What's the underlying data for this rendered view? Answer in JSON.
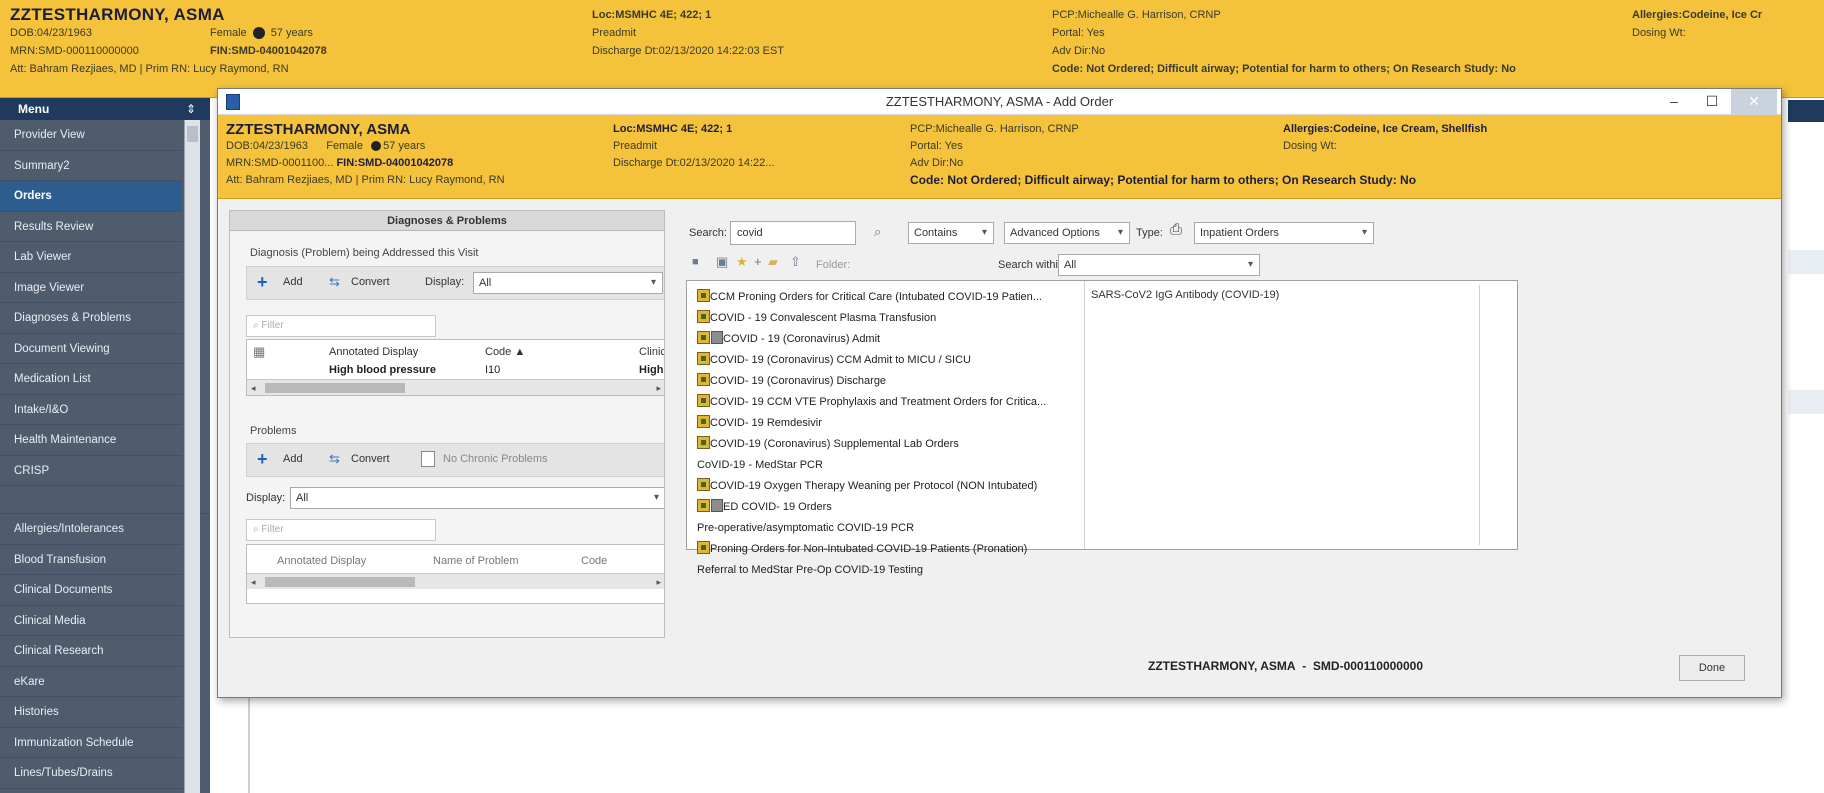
{
  "banner": {
    "patient_name": "ZZTESTHARMONY, ASMA",
    "dob": "DOB:04/23/1963",
    "mrn": "MRN:SMD-000110000000",
    "attending": "Att: Bahram Rezjiaes, MD | Prim RN: Lucy Raymond, RN",
    "sex": "Female",
    "age": "57 years",
    "fin": "FIN:SMD-04001042078",
    "loc": "Loc:MSMHC 4E; 422; 1",
    "encounter_type": "Preadmit",
    "discharge": "Discharge Dt:02/13/2020 14:22:03 EST",
    "pcp": "PCP:Michealle G. Harrison, CRNP",
    "portal": "Portal: Yes",
    "adv_dir": "Adv Dir:No",
    "code": "Code: Not Ordered; Difficult airway; Potential for harm to others; On Research Study: No",
    "allergies": "Allergies:Codeine, Ice Cr",
    "dosing_wt": "Dosing Wt:"
  },
  "menu": {
    "header": "Menu",
    "pin": "⇕",
    "items_top": [
      {
        "label": "Provider View",
        "active": false
      },
      {
        "label": "Summary2",
        "active": false
      },
      {
        "label": "Orders",
        "active": true
      },
      {
        "label": "Results Review",
        "active": false
      },
      {
        "label": "Lab Viewer",
        "active": false
      },
      {
        "label": "Image Viewer",
        "active": false
      },
      {
        "label": "Diagnoses & Problems",
        "active": false
      },
      {
        "label": "Document Viewing",
        "active": false
      },
      {
        "label": "Medication List",
        "active": false
      },
      {
        "label": "Intake/I&O",
        "active": false
      },
      {
        "label": "Health Maintenance",
        "active": false
      },
      {
        "label": "CRISP",
        "active": false
      }
    ],
    "items_bottom": [
      {
        "label": "Allergies/Intolerances"
      },
      {
        "label": "Blood Transfusion"
      },
      {
        "label": "Clinical Documents"
      },
      {
        "label": "Clinical Media"
      },
      {
        "label": "Clinical Research"
      },
      {
        "label": "eKare"
      },
      {
        "label": "Histories"
      },
      {
        "label": "Immunization Schedule"
      },
      {
        "label": "Lines/Tubes/Drains"
      }
    ]
  },
  "dialog": {
    "title": "ZZTESTHARMONY, ASMA - Add Order",
    "min": "–",
    "max": "☐",
    "close": "✕",
    "banner": {
      "patient_name": "ZZTESTHARMONY, ASMA",
      "dob": "DOB:04/23/1963",
      "sex": "Female",
      "age": "57 years",
      "mrn": "MRN:SMD-0001100...",
      "fin": "FIN:SMD-04001042078",
      "attending": "Att: Bahram Rezjiaes, MD | Prim RN: Lucy Raymond, RN",
      "loc": "Loc:MSMHC 4E; 422; 1",
      "encounter_type": "Preadmit",
      "discharge": "Discharge Dt:02/13/2020 14:22...",
      "pcp": "PCP:Michealle G. Harrison, CRNP",
      "portal": "Portal: Yes",
      "adv_dir": "Adv Dir:No",
      "allergies": "Allergies:Codeine, Ice Cream, Shellfish",
      "dosing_wt": "Dosing Wt:",
      "code": "Code: Not Ordered; Difficult airway; Potential for harm to others; On Research Study: No"
    },
    "dx_panel": {
      "header": "Diagnoses & Problems",
      "diagnosis_section_label": "Diagnosis (Problem) being Addressed this Visit",
      "add": "Add",
      "convert": "Convert",
      "display_label": "Display:",
      "display_value": "All",
      "filter_placeholder": "Filter",
      "grid_headers": {
        "annotated_display": "Annotated Display",
        "code": "Code ▲",
        "clinical": "Clinic"
      },
      "grid_row": {
        "annotated_display": "High blood pressure",
        "code": "I10",
        "clinical": "High"
      },
      "problems_label": "Problems",
      "no_chronic": "No Chronic Problems",
      "problems_display_label": "Display:",
      "problems_display_value": "All",
      "problems_filter_placeholder": "Filter",
      "problems_grid_headers": {
        "annotated_display": "Annotated Display",
        "name_of_problem": "Name of Problem",
        "code": "Code"
      }
    },
    "search": {
      "label": "Search:",
      "value": "covid",
      "contains": "Contains",
      "advanced": "Advanced Options",
      "type_label": "Type:",
      "type_value": "Inpatient Orders",
      "folder": "Folder:",
      "search_within_label": "Search within:",
      "search_within_value": "All"
    },
    "results": [
      {
        "text": "CCM Proning Orders for Critical Care (Intubated COVID-19 Patien...",
        "icon": "order-set",
        "icon2": false
      },
      {
        "text": "COVID - 19 Convalescent Plasma Transfusion",
        "icon": "order-set",
        "icon2": false
      },
      {
        "text": "COVID - 19 (Coronavirus) Admit",
        "icon": "order-set",
        "icon2": true
      },
      {
        "text": "COVID- 19 (Coronavirus) CCM Admit to MICU / SICU",
        "icon": "order-set",
        "icon2": false
      },
      {
        "text": "COVID- 19 (Coronavirus) Discharge",
        "icon": "order-set",
        "icon2": false
      },
      {
        "text": "COVID- 19 CCM VTE Prophylaxis and Treatment Orders for Critica...",
        "icon": "order-set",
        "icon2": false
      },
      {
        "text": "COVID- 19 Remdesivir",
        "icon": "order-set",
        "icon2": false
      },
      {
        "text": "COVID-19 (Coronavirus) Supplemental Lab Orders",
        "icon": "order-set",
        "icon2": false
      },
      {
        "text": "CoVID-19 - MedStar PCR",
        "icon": "none",
        "icon2": false
      },
      {
        "text": "COVID-19 Oxygen Therapy Weaning per Protocol (NON Intubated)",
        "icon": "order-set",
        "icon2": false
      },
      {
        "text": "ED COVID- 19 Orders",
        "icon": "order-set",
        "icon2": true
      },
      {
        "text": "Pre-operative/asymptomatic COVID-19 PCR",
        "icon": "none",
        "icon2": false
      },
      {
        "text": "Proning Orders for Non-Intubated COVID-19 Patients (Pronation)",
        "icon": "order-set",
        "icon2": false
      },
      {
        "text": "Referral to MedStar Pre-Op COVID-19 Testing",
        "icon": "none",
        "icon2": false
      }
    ],
    "detail": "SARS-CoV2 IgG Antibody (COVID-19)",
    "footer_patient": "ZZTESTHARMONY, ASMA",
    "footer_mrn": "SMD-000110000000",
    "done": "Done"
  }
}
